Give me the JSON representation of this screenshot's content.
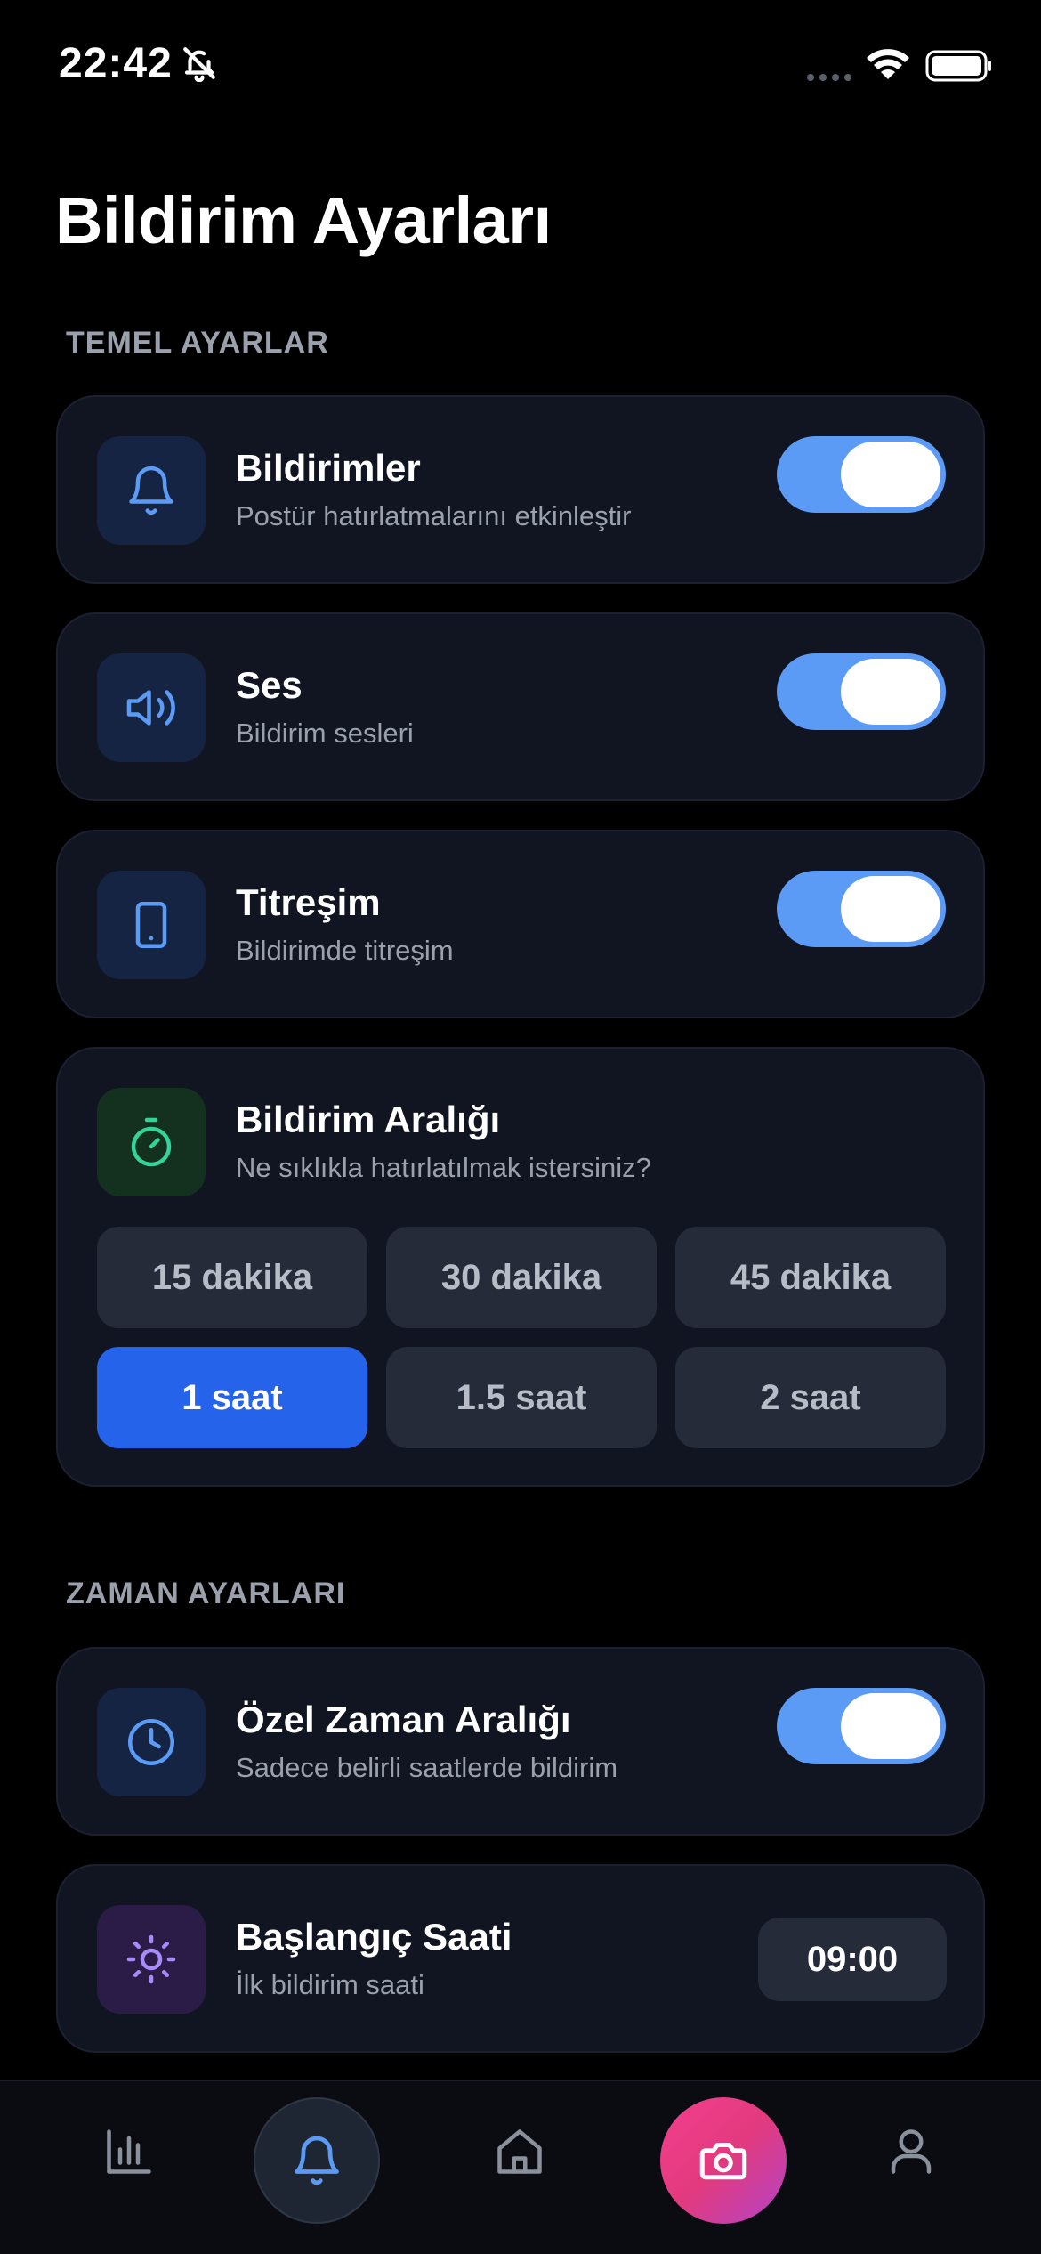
{
  "status_bar": {
    "time": "22:42"
  },
  "page": {
    "title": "Bildirim Ayarları"
  },
  "sections": {
    "basic": "TEMEL AYARLAR",
    "time": "ZAMAN AYARLARI"
  },
  "settings": {
    "notifications": {
      "title": "Bildirimler",
      "subtitle": "Postür hatırlatmalarını etkinleştir",
      "enabled": true,
      "icon": "bell-icon"
    },
    "sound": {
      "title": "Ses",
      "subtitle": "Bildirim sesleri",
      "enabled": true,
      "icon": "speaker-icon"
    },
    "vibration": {
      "title": "Titreşim",
      "subtitle": "Bildirimde titreşim",
      "enabled": true,
      "icon": "phone-icon"
    },
    "interval": {
      "title": "Bildirim Aralığı",
      "subtitle": "Ne sıklıkla hatırlatılmak istersiniz?",
      "icon": "timer-icon",
      "options": [
        "15 dakika",
        "30 dakika",
        "45 dakika",
        "1 saat",
        "1.5 saat",
        "2 saat"
      ],
      "selected": "1 saat"
    },
    "custom_time": {
      "title": "Özel Zaman Aralığı",
      "subtitle": "Sadece belirli saatlerde bildirim",
      "enabled": true,
      "icon": "clock-icon"
    },
    "start_time": {
      "title": "Başlangıç Saati",
      "subtitle": "İlk bildirim saati",
      "value": "09:00",
      "icon": "sun-icon"
    }
  },
  "nav": {
    "items": [
      "chart-icon",
      "bell-icon",
      "home-icon",
      "camera-icon",
      "user-icon"
    ],
    "active": "bell-icon"
  },
  "colors": {
    "background": "#000000",
    "card": "#111521",
    "toggle_on": "#5b9bf5",
    "accent_blue": "#2563eb",
    "icon_blue": "#5b9bf5",
    "icon_green": "#34d399",
    "icon_purple": "#a78bfa",
    "camera_gradient_start": "#f43f8e",
    "camera_gradient_end": "#b344c7"
  }
}
